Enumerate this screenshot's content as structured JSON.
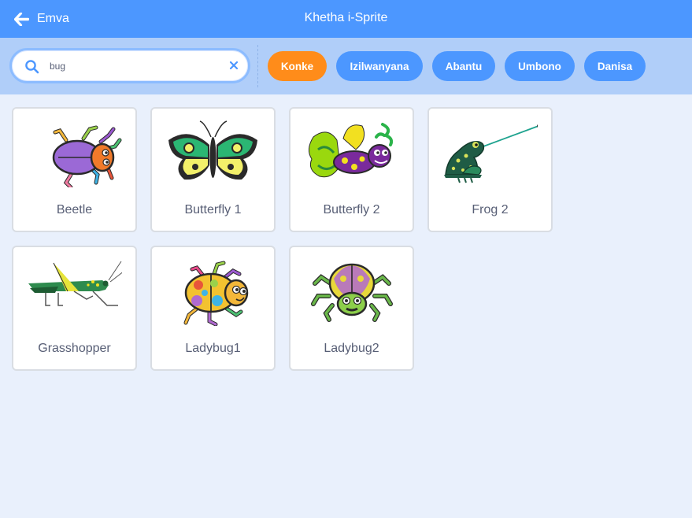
{
  "header": {
    "back_label": "Emva",
    "title": "Khetha i-Sprite"
  },
  "search": {
    "value": "bug"
  },
  "tags": [
    {
      "label": "Konke",
      "active": true
    },
    {
      "label": "Izilwanyana",
      "active": false
    },
    {
      "label": "Abantu",
      "active": false
    },
    {
      "label": "Umbono",
      "active": false
    },
    {
      "label": "Danisa",
      "active": false
    }
  ],
  "sprites": [
    {
      "name": "Beetle",
      "icon": "beetle-icon"
    },
    {
      "name": "Butterfly 1",
      "icon": "butterfly-icon"
    },
    {
      "name": "Butterfly 2",
      "icon": "butterfly-icon"
    },
    {
      "name": "Frog 2",
      "icon": "frog-icon"
    },
    {
      "name": "Grasshopper",
      "icon": "grasshopper-icon"
    },
    {
      "name": "Ladybug1",
      "icon": "ladybug-icon"
    },
    {
      "name": "Ladybug2",
      "icon": "ladybug-icon"
    }
  ],
  "colors": {
    "header_bg": "#4c97ff",
    "filterbar_bg": "#b0cef9",
    "active_tag": "#ff8c1a",
    "tag": "#4c97ff",
    "page_bg": "#e9f0fc"
  }
}
